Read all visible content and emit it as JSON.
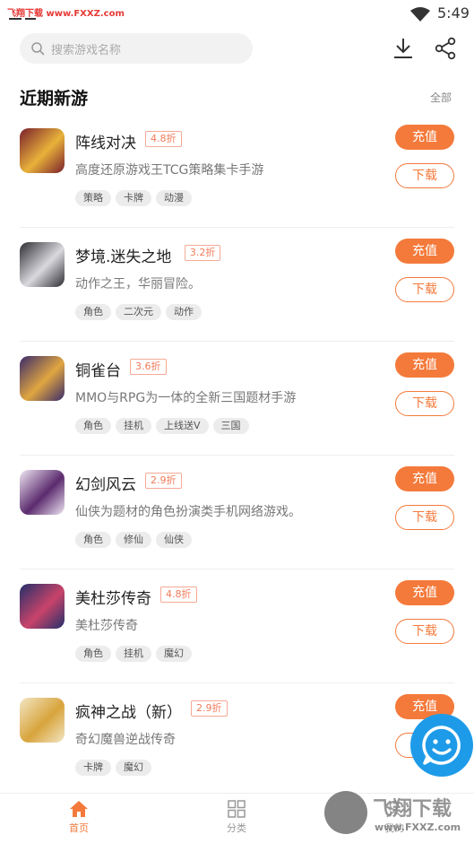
{
  "status_bar": {
    "watermark_text": "飞翔下载 www.FXXZ.com",
    "time": "5:49"
  },
  "search": {
    "placeholder": "搜索游戏名称"
  },
  "section": {
    "title": "近期新游",
    "all_label": "全部"
  },
  "buttons": {
    "recharge_label": "充值",
    "download_label": "下载"
  },
  "games": [
    {
      "name": "阵线对决",
      "discount": "4.8折",
      "desc": "高度还原游戏王TCG策略集卡手游",
      "tags": [
        "策略",
        "卡牌",
        "动漫"
      ],
      "icon": "yugioh-game-icon",
      "icon_colors": [
        "#7a1e2c",
        "#e8b23a"
      ]
    },
    {
      "name": "梦境.迷失之地",
      "discount": "3.2折",
      "desc": "动作之王，华丽冒险。",
      "tags": [
        "角色",
        "二次元",
        "动作"
      ],
      "icon": "dark-knight-game-icon",
      "icon_colors": [
        "#2c2c32",
        "#d9d9de"
      ]
    },
    {
      "name": "铜雀台",
      "discount": "3.6折",
      "desc": "MMO与RPG为一体的全新三国题材手游",
      "tags": [
        "角色",
        "挂机",
        "上线送V",
        "三国"
      ],
      "icon": "three-kingdoms-game-icon",
      "icon_colors": [
        "#3a2a6b",
        "#e0a640"
      ]
    },
    {
      "name": "幻剑风云",
      "discount": "2.9折",
      "desc": "仙侠为题材的角色扮演类手机网络游戏。",
      "tags": [
        "角色",
        "修仙",
        "仙侠"
      ],
      "icon": "sword-calligraphy-game-icon",
      "icon_colors": [
        "#efe6f3",
        "#5b2b6e"
      ]
    },
    {
      "name": "美杜莎传奇",
      "discount": "4.8折",
      "desc": "美杜莎传奇",
      "tags": [
        "角色",
        "挂机",
        "魔幻"
      ],
      "icon": "medusa-game-icon",
      "icon_colors": [
        "#23306b",
        "#c8436a"
      ]
    },
    {
      "name": "疯神之战（新）",
      "discount": "2.9折",
      "desc": "奇幻魔兽逆战传奇",
      "tags": [
        "卡牌",
        "魔幻"
      ],
      "icon": "angel-game-icon",
      "icon_colors": [
        "#f2e6c4",
        "#d8a43c"
      ]
    }
  ],
  "bottom_nav": [
    {
      "label": "首页",
      "icon": "home-icon",
      "active": true
    },
    {
      "label": "分类",
      "icon": "grid-icon",
      "active": false
    },
    {
      "label": "我的",
      "icon": "profile-icon",
      "active": false
    }
  ],
  "watermark": {
    "brand": "飞翔下载",
    "url": "www.FXXZ.com"
  },
  "colors": {
    "accent": "#f47a3b",
    "discount_text": "#f07b5a",
    "fab": "#1e9be8"
  }
}
